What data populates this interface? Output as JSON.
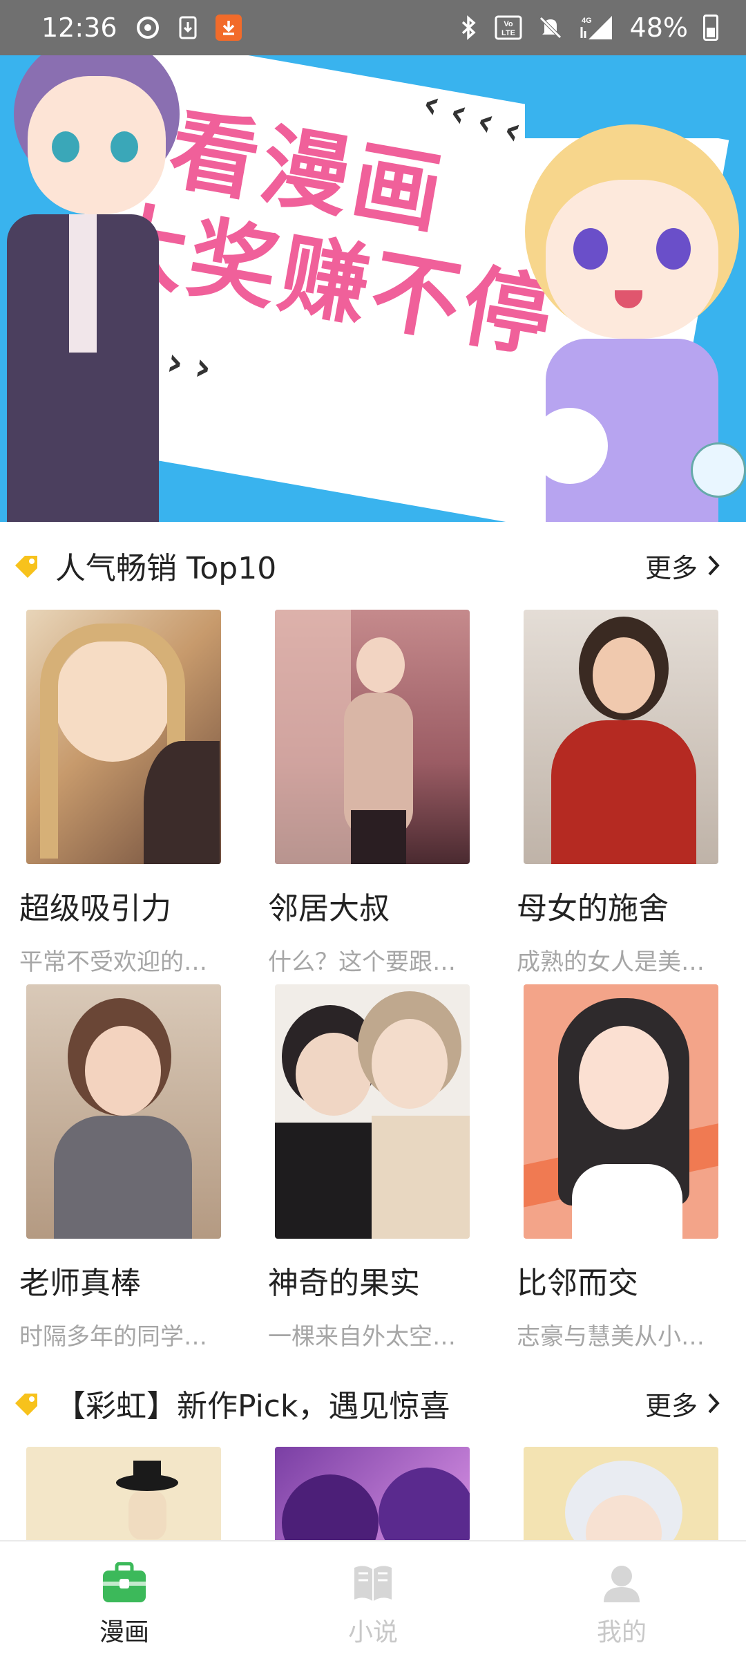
{
  "status_bar": {
    "time": "12:36",
    "network": "4G",
    "volte": "Vo LTE",
    "battery": "48%"
  },
  "banner": {
    "line1": "看漫画",
    "line2": "大奖赚不停"
  },
  "sections": [
    {
      "title": "人气畅销 Top10",
      "more": "更多",
      "items": [
        {
          "title": "超级吸引力",
          "desc": "平常不受欢迎的家..."
        },
        {
          "title": "邻居大叔",
          "desc": "什么？这个要跟我..."
        },
        {
          "title": "母女的施舍",
          "desc": "成熟的女人是美酒..."
        },
        {
          "title": "老师真棒",
          "desc": "时隔多年的同学会..."
        },
        {
          "title": "神奇的果实",
          "desc": "一棵来自外太空的..."
        },
        {
          "title": "比邻而交",
          "desc": "志豪与慧美从小一..."
        }
      ]
    },
    {
      "title": "【彩虹】新作Pick，遇见惊喜",
      "more": "更多"
    }
  ],
  "bottom_nav": [
    {
      "label": "漫画",
      "active": true
    },
    {
      "label": "小说",
      "active": false
    },
    {
      "label": "我的",
      "active": false
    }
  ],
  "colors": {
    "accent_green": "#3cb95a",
    "banner_blue": "#39b3ee",
    "banner_pink": "#f0609a",
    "tag_yellow": "#f7c21c"
  }
}
